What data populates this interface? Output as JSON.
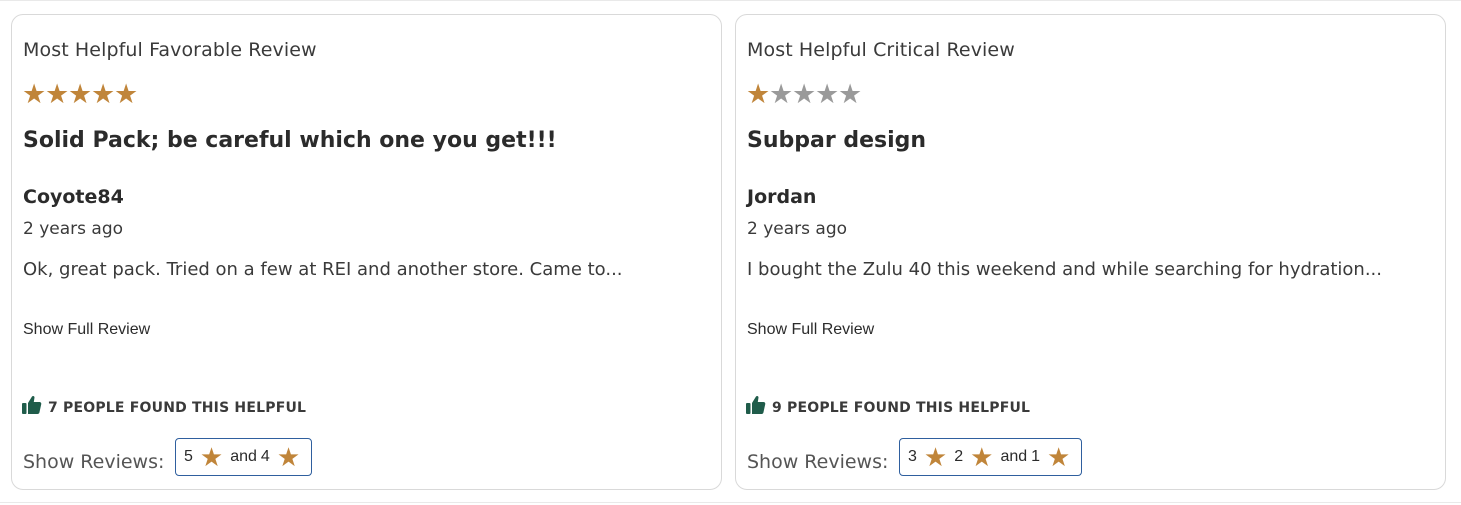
{
  "colors": {
    "star_filled": "#c0853a",
    "star_empty": "#9a9a9a",
    "thumb": "#1f5c4a",
    "button_border": "#2f5f9e"
  },
  "favorable": {
    "heading": "Most Helpful Favorable Review",
    "rating": 5,
    "rating_max": 5,
    "title": "Solid Pack; be careful which one you get!!!",
    "reviewer": "Coyote84",
    "date": "2 years ago",
    "excerpt": "Ok, great pack. Tried on a few at REI and another store. Came to...",
    "show_full_label": "Show Full Review",
    "helpful_text": "7 PEOPLE FOUND THIS HELPFUL",
    "show_reviews_label": "Show Reviews:",
    "filter": {
      "n1": "5",
      "and": "and",
      "n2": "4"
    }
  },
  "critical": {
    "heading": "Most Helpful Critical Review",
    "rating": 1,
    "rating_max": 5,
    "title": "Subpar design",
    "reviewer": "Jordan",
    "date": "2 years ago",
    "excerpt": "I bought the Zulu 40 this weekend and while searching for hydration...",
    "show_full_label": "Show Full Review",
    "helpful_text": "9 PEOPLE FOUND THIS HELPFUL",
    "show_reviews_label": "Show Reviews:",
    "filter": {
      "n1": "3",
      "n2": "2",
      "and": "and",
      "n3": "1"
    }
  }
}
